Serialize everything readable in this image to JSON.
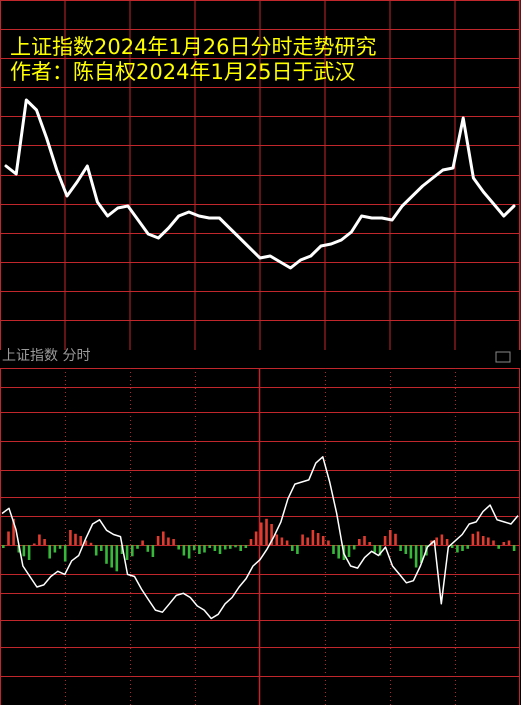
{
  "title": {
    "line1": "上证指数2024年1月26日分时走势研究",
    "line2": "作者：陈自权2024年1月25日于武汉"
  },
  "lower_panel": {
    "label": "上证指数 分时"
  },
  "colors": {
    "background": "#000000",
    "grid": "#c0272d",
    "grid_dotted": "#b3262b",
    "title": "#ffff00",
    "line": "#ffffff",
    "bar_up": "#e03b2f",
    "bar_down": "#38b83a"
  },
  "chart_data": [
    {
      "type": "line",
      "title": "上证指数2024年1月26日分时走势研究",
      "subtitle": "作者：陈自权2024年1月25日于武汉",
      "x": [
        0,
        2,
        4,
        6,
        8,
        10,
        12,
        14,
        16,
        18,
        20,
        22,
        24,
        26,
        28,
        30,
        32,
        34,
        36,
        38,
        40,
        42,
        44,
        46,
        48,
        50,
        52,
        54,
        56,
        58,
        60,
        62,
        64,
        66,
        68,
        70,
        72,
        74,
        76,
        78,
        80,
        82,
        84,
        86,
        88,
        90,
        92,
        94,
        96,
        98,
        100
      ],
      "values": [
        6.2,
        5.8,
        9.5,
        9.0,
        7.6,
        6.0,
        4.7,
        5.4,
        6.2,
        4.4,
        3.7,
        4.1,
        4.2,
        3.5,
        2.8,
        2.6,
        3.1,
        3.7,
        3.9,
        3.7,
        3.6,
        3.6,
        3.1,
        2.6,
        2.1,
        1.6,
        1.7,
        1.4,
        1.1,
        1.5,
        1.7,
        2.2,
        2.3,
        2.5,
        2.9,
        3.7,
        3.6,
        3.6,
        3.5,
        4.2,
        4.7,
        5.2,
        5.6,
        6.0,
        6.1,
        8.6,
        5.6,
        4.9,
        4.3,
        3.7,
        4.2
      ],
      "xlim": [
        0,
        100
      ],
      "ylim": [
        0,
        12
      ],
      "grid": true
    },
    {
      "type": "bar",
      "x": [
        0,
        1,
        2,
        3,
        4,
        5,
        6,
        7,
        8,
        9,
        10,
        11,
        12,
        13,
        14,
        15,
        16,
        17,
        18,
        19,
        20,
        21,
        22,
        23,
        24,
        25,
        26,
        27,
        28,
        29,
        30,
        31,
        32,
        33,
        34,
        35,
        36,
        37,
        38,
        39,
        40,
        41,
        42,
        43,
        44,
        45,
        46,
        47,
        48,
        49,
        50,
        51,
        52,
        53,
        54,
        55,
        56,
        57,
        58,
        59,
        60,
        61,
        62,
        63,
        64,
        65,
        66,
        67,
        68,
        69,
        70,
        71,
        72,
        73,
        74,
        75,
        76,
        77,
        78,
        79,
        80,
        81,
        82,
        83,
        84,
        85,
        86,
        87,
        88,
        89,
        90,
        91,
        92,
        93,
        94,
        95,
        96,
        97,
        98,
        99
      ],
      "values": [
        -4,
        18,
        35,
        -10,
        -15,
        -20,
        2,
        14,
        8,
        -18,
        -10,
        -5,
        -22,
        20,
        15,
        12,
        6,
        3,
        -14,
        -8,
        -25,
        -30,
        -35,
        -12,
        -20,
        -15,
        -5,
        6,
        -9,
        -16,
        12,
        18,
        10,
        8,
        -6,
        -14,
        -18,
        -7,
        -12,
        -10,
        -4,
        -8,
        -12,
        -6,
        -5,
        -3,
        -8,
        -4,
        8,
        18,
        30,
        35,
        28,
        14,
        10,
        6,
        -8,
        -12,
        14,
        10,
        20,
        16,
        12,
        6,
        -12,
        -18,
        -20,
        -16,
        -6,
        8,
        12,
        4,
        -10,
        -14,
        12,
        20,
        15,
        -8,
        -12,
        -18,
        -30,
        -24,
        -14,
        6,
        10,
        14,
        8,
        -4,
        -10,
        -8,
        -5,
        15,
        18,
        12,
        10,
        6,
        -5,
        4,
        6,
        -8
      ],
      "line_values": [
        30,
        35,
        15,
        -20,
        -30,
        -40,
        -38,
        -30,
        -25,
        -28,
        -15,
        -10,
        6,
        20,
        24,
        14,
        10,
        8,
        -28,
        -30,
        -42,
        -52,
        -62,
        -64,
        -56,
        -48,
        -46,
        -50,
        -58,
        -62,
        -70,
        -66,
        -56,
        -50,
        -40,
        -32,
        -20,
        -14,
        -4,
        8,
        22,
        44,
        58,
        60,
        62,
        78,
        84,
        60,
        30,
        -8,
        -20,
        -22,
        -12,
        -6,
        -10,
        -2,
        -20,
        -28,
        -36,
        -34,
        -20,
        -2,
        4,
        -56,
        -2,
        4,
        10,
        20,
        22,
        32,
        38,
        24,
        22,
        20,
        28
      ],
      "ylim": [
        -100,
        100
      ],
      "grid": true
    }
  ]
}
